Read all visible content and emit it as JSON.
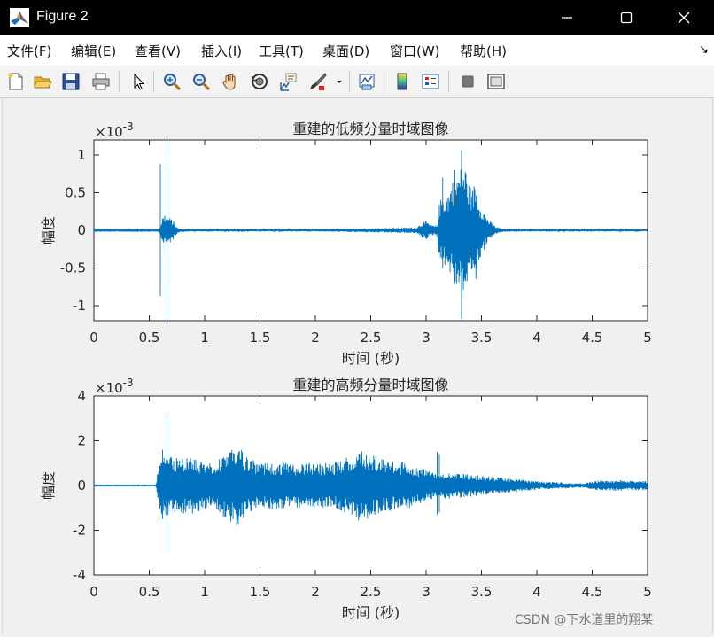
{
  "window": {
    "title": "Figure 2",
    "minimize_glyph": "—",
    "maximize_glyph": "☐",
    "close_glyph": "✕"
  },
  "menubar": {
    "items": [
      "文件(F)",
      "编辑(E)",
      "查看(V)",
      "插入(I)",
      "工具(T)",
      "桌面(D)",
      "窗口(W)",
      "帮助(H)"
    ],
    "undock_glyph": "↘"
  },
  "toolbar": {
    "icons": [
      "new-figure-icon",
      "open-file-icon",
      "save-icon",
      "print-icon",
      "pointer-arrow-icon",
      "zoom-in-icon",
      "zoom-out-icon",
      "pan-hand-icon",
      "rotate-3d-icon",
      "data-cursor-icon",
      "brush-icon",
      "dropdown-arrow-icon",
      "link-plot-icon",
      "colorbar-icon",
      "legend-icon",
      "hide-plot-tools-icon",
      "show-plot-tools-icon"
    ]
  },
  "chart_data": [
    {
      "type": "line",
      "title": "重建的低频分量时域图像",
      "xlabel": "时间 (秒)",
      "ylabel": "幅度",
      "exponent_label": "×10",
      "exponent_power": "-3",
      "xlim": [
        0,
        5
      ],
      "ylim": [
        -1.2,
        1.2
      ],
      "xticks": [
        "0",
        "0.5",
        "1",
        "1.5",
        "2",
        "2.5",
        "3",
        "3.5",
        "4",
        "4.5",
        "5"
      ],
      "yticks": [
        "1",
        "0.5",
        "0",
        "-0.5",
        "-1"
      ],
      "ytick_values": [
        1,
        0.5,
        0,
        -0.5,
        -1
      ],
      "grid": false,
      "line_color": "#0072bd",
      "envelope": {
        "t": [
          0,
          0.58,
          0.6,
          0.62,
          0.64,
          0.66,
          0.68,
          0.7,
          0.72,
          0.74,
          0.76,
          0.8,
          1.0,
          1.5,
          2.0,
          2.55,
          2.9,
          2.93,
          2.96,
          3.0,
          3.04,
          3.08,
          3.1,
          3.12,
          3.15,
          3.18,
          3.21,
          3.24,
          3.27,
          3.3,
          3.33,
          3.36,
          3.39,
          3.42,
          3.45,
          3.48,
          3.51,
          3.55,
          3.6,
          3.65,
          3.7,
          4.0,
          5.0
        ],
        "amp": [
          0.01,
          0.01,
          0.05,
          0.18,
          0.22,
          0.2,
          0.18,
          0.15,
          0.12,
          0.06,
          0.03,
          0.02,
          0.015,
          0.015,
          0.015,
          0.03,
          0.04,
          0.06,
          0.1,
          0.12,
          0.08,
          0.06,
          0.08,
          0.35,
          0.5,
          0.45,
          0.55,
          0.7,
          0.75,
          0.8,
          0.9,
          0.85,
          0.6,
          0.55,
          0.7,
          0.4,
          0.3,
          0.18,
          0.08,
          0.04,
          0.02,
          0.015,
          0.015
        ]
      },
      "spikes": [
        {
          "t": 0.6,
          "hi": 0.88,
          "lo": -0.87
        },
        {
          "t": 0.66,
          "hi": 1.22,
          "lo": -1.22
        },
        {
          "t": 3.32,
          "hi": 1.06,
          "lo": -1.18
        },
        {
          "t": 3.15,
          "hi": 0.7,
          "lo": -0.5
        },
        {
          "t": 3.26,
          "hi": 0.8,
          "lo": -0.7
        }
      ]
    },
    {
      "type": "line",
      "title": "重建的高频分量时域图像",
      "xlabel": "时间 (秒)",
      "ylabel": "幅度",
      "exponent_label": "×10",
      "exponent_power": "-3",
      "xlim": [
        0,
        5
      ],
      "ylim": [
        -4,
        4
      ],
      "xticks": [
        "0",
        "0.5",
        "1",
        "1.5",
        "2",
        "2.5",
        "3",
        "3.5",
        "4",
        "4.5",
        "5"
      ],
      "yticks": [
        "4",
        "2",
        "0",
        "-2",
        "-4"
      ],
      "ytick_values": [
        4,
        2,
        0,
        -2,
        -4
      ],
      "grid": false,
      "line_color": "#0072bd",
      "envelope": {
        "t": [
          0,
          0.56,
          0.59,
          0.62,
          0.7,
          0.8,
          0.9,
          1.0,
          1.05,
          1.1,
          1.2,
          1.3,
          1.35,
          1.4,
          1.5,
          1.6,
          1.8,
          2.0,
          2.2,
          2.3,
          2.4,
          2.5,
          2.6,
          2.7,
          2.85,
          3.0,
          3.1,
          3.2,
          3.4,
          3.6,
          3.8,
          4.0,
          4.2,
          4.4,
          4.6,
          5.0
        ],
        "amp": [
          0.02,
          0.02,
          1.2,
          1.4,
          1.3,
          1.25,
          1.3,
          1.05,
          1.05,
          1.2,
          1.5,
          1.9,
          1.5,
          1.3,
          0.95,
          1.05,
          1.0,
          1.0,
          1.05,
          1.3,
          1.7,
          1.4,
          1.2,
          1.1,
          1.0,
          0.7,
          0.55,
          0.6,
          0.5,
          0.4,
          0.3,
          0.2,
          0.15,
          0.1,
          0.25,
          0.2
        ]
      },
      "spikes": [
        {
          "t": 0.66,
          "hi": 3.1,
          "lo": -3.0
        },
        {
          "t": 0.62,
          "hi": 1.6,
          "lo": -1.5
        },
        {
          "t": 3.1,
          "hi": 1.5,
          "lo": -1.3
        },
        {
          "t": 3.12,
          "hi": 1.4,
          "lo": -1.2
        }
      ]
    }
  ],
  "watermark": "CSDN @下水道里的翔某"
}
